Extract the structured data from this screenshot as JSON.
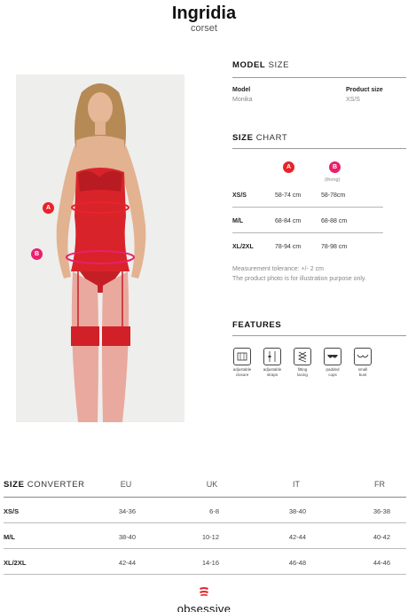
{
  "product": {
    "name": "Ingridia",
    "type": "corset"
  },
  "photo": {
    "markers": [
      {
        "id": "A",
        "color": "#e8232a"
      },
      {
        "id": "B",
        "color": "#e8206d"
      }
    ]
  },
  "model_size": {
    "title_bold": "MODEL",
    "title_light": "SIZE",
    "model_label": "Model",
    "model_value": "Monika",
    "size_label": "Product size",
    "size_value": "XS/S"
  },
  "size_chart": {
    "title_bold": "SIZE",
    "title_light": "CHART",
    "col_a": "A",
    "col_b": "B",
    "col_b_note": "(thong)",
    "rows": [
      {
        "size": "XS/S",
        "a": "58-74 cm",
        "b": "58-78cm"
      },
      {
        "size": "M/L",
        "a": "68-84 cm",
        "b": "68-88 cm"
      },
      {
        "size": "XL/2XL",
        "a": "78-94 cm",
        "b": "78-98 cm"
      }
    ],
    "note_1": "Measurement tolerance: +/- 2 cm",
    "note_2": "The product photo is for illustration purpose only."
  },
  "features": {
    "title": "FEATURES",
    "items": [
      {
        "icon": "adjustable-closure-icon",
        "label_1": "adjustable",
        "label_2": "closure"
      },
      {
        "icon": "adjustable-straps-icon",
        "label_1": "adjustable",
        "label_2": "straps"
      },
      {
        "icon": "fitting-lacing-icon",
        "label_1": "fitting",
        "label_2": "lacing"
      },
      {
        "icon": "padded-cups-icon",
        "label_1": "padded",
        "label_2": "cups"
      },
      {
        "icon": "small-bust-icon",
        "label_1": "small",
        "label_2": "bust"
      }
    ]
  },
  "size_converter": {
    "title_bold": "SIZE",
    "title_light": "CONVERTER",
    "columns": [
      "EU",
      "UK",
      "IT",
      "FR"
    ],
    "rows": [
      {
        "size": "XS/S",
        "eu": "34-36",
        "uk": "6-8",
        "it": "38-40",
        "fr": "36-38"
      },
      {
        "size": "M/L",
        "eu": "38-40",
        "uk": "10-12",
        "it": "42-44",
        "fr": "40-42"
      },
      {
        "size": "XL/2XL",
        "eu": "42-44",
        "uk": "14-16",
        "it": "46-48",
        "fr": "44-46"
      }
    ]
  },
  "brand": {
    "name": "obsessive",
    "color": "#e8232a"
  }
}
